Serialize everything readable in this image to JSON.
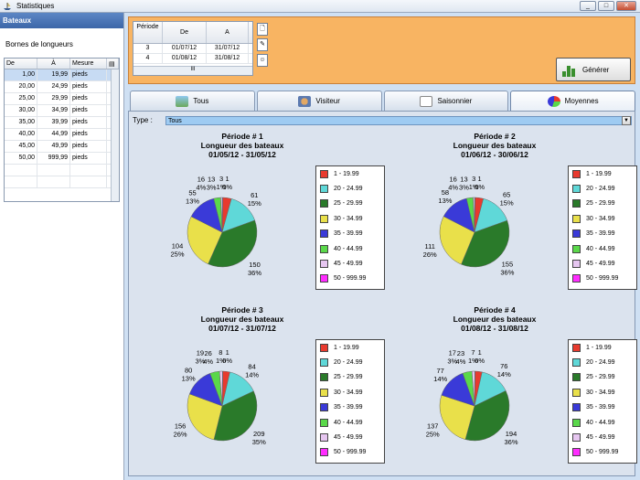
{
  "window": {
    "title": "Statistiques",
    "buttons": {
      "minimize": "_",
      "maximize": "□",
      "close": "✕"
    }
  },
  "left_panel": {
    "header": "Bateaux",
    "caption": "Bornes de longueurs",
    "columns": [
      "De",
      "À",
      "Mesure"
    ],
    "rows": [
      {
        "de": "1,00",
        "a": "19,99",
        "mesure": "pieds"
      },
      {
        "de": "20,00",
        "a": "24,99",
        "mesure": "pieds"
      },
      {
        "de": "25,00",
        "a": "29,99",
        "mesure": "pieds"
      },
      {
        "de": "30,00",
        "a": "34,99",
        "mesure": "pieds"
      },
      {
        "de": "35,00",
        "a": "39,99",
        "mesure": "pieds"
      },
      {
        "de": "40,00",
        "a": "44,99",
        "mesure": "pieds"
      },
      {
        "de": "45,00",
        "a": "49,99",
        "mesure": "pieds"
      },
      {
        "de": "50,00",
        "a": "999,99",
        "mesure": "pieds"
      }
    ]
  },
  "period_grid": {
    "columns": [
      "Période",
      "De",
      "A"
    ],
    "rows": [
      {
        "periode": "3",
        "de": "01/07/12",
        "a": "31/07/12"
      },
      {
        "periode": "4",
        "de": "01/08/12",
        "a": "31/08/12"
      }
    ],
    "scrollbar_label": "III"
  },
  "generate_button": "Générer",
  "tabs": [
    {
      "label": "Tous",
      "active": false
    },
    {
      "label": "Visiteur",
      "active": false
    },
    {
      "label": "Saisonnier",
      "active": false
    },
    {
      "label": "Moyennes",
      "active": true
    }
  ],
  "type_filter": {
    "label": "Type :",
    "value": "Tous"
  },
  "legend_labels": [
    "1 - 19.99",
    "20 - 24.99",
    "25 - 29.99",
    "30 - 34.99",
    "35 - 39.99",
    "40 - 44.99",
    "45 - 49.99",
    "50 - 999.99"
  ],
  "legend_colors": [
    "#e83a2e",
    "#5fd8d8",
    "#2a7a2a",
    "#e9e04a",
    "#3a3ad8",
    "#5ad84a",
    "#e6c6f0",
    "#ff2cff"
  ],
  "chart_data": [
    {
      "type": "pie",
      "title": "Période # 1",
      "subtitle": "Longueur des bateaux",
      "dates": "01/05/12 - 31/05/12",
      "categories": [
        "1 - 19.99",
        "20 - 24.99",
        "25 - 29.99",
        "30 - 34.99",
        "35 - 39.99",
        "40 - 44.99",
        "45 - 49.99",
        "50 - 999.99"
      ],
      "values": [
        16,
        61,
        150,
        104,
        55,
        13,
        3,
        1
      ],
      "percents": [
        "4%",
        "15%",
        "36%",
        "25%",
        "13%",
        "3%",
        "1%",
        "0%"
      ]
    },
    {
      "type": "pie",
      "title": "Période # 2",
      "subtitle": "Longueur des bateaux",
      "dates": "01/06/12 - 30/06/12",
      "categories": [
        "1 - 19.99",
        "20 - 24.99",
        "25 - 29.99",
        "30 - 34.99",
        "35 - 39.99",
        "40 - 44.99",
        "45 - 49.99",
        "50 - 999.99"
      ],
      "values": [
        16,
        65,
        155,
        111,
        58,
        13,
        3,
        1
      ],
      "percents": [
        "4%",
        "15%",
        "36%",
        "26%",
        "13%",
        "3%",
        "1%",
        "0%"
      ]
    },
    {
      "type": "pie",
      "title": "Période # 3",
      "subtitle": "Longueur des bateaux",
      "dates": "01/07/12 - 31/07/12",
      "categories": [
        "1 - 19.99",
        "20 - 24.99",
        "25 - 29.99",
        "30 - 34.99",
        "35 - 39.99",
        "40 - 44.99",
        "45 - 49.99",
        "50 - 999.99"
      ],
      "values": [
        19,
        84,
        209,
        156,
        80,
        26,
        8,
        1
      ],
      "percents": [
        "3%",
        "14%",
        "35%",
        "26%",
        "13%",
        "4%",
        "1%",
        "0%"
      ]
    },
    {
      "type": "pie",
      "title": "Période # 4",
      "subtitle": "Longueur des bateaux",
      "dates": "01/08/12 - 31/08/12",
      "categories": [
        "1 - 19.99",
        "20 - 24.99",
        "25 - 29.99",
        "30 - 34.99",
        "35 - 39.99",
        "40 - 44.99",
        "45 - 49.99",
        "50 - 999.99"
      ],
      "values": [
        17,
        76,
        194,
        137,
        77,
        23,
        7,
        1
      ],
      "percents": [
        "3%",
        "14%",
        "36%",
        "25%",
        "14%",
        "4%",
        "1%",
        "0%"
      ]
    }
  ]
}
